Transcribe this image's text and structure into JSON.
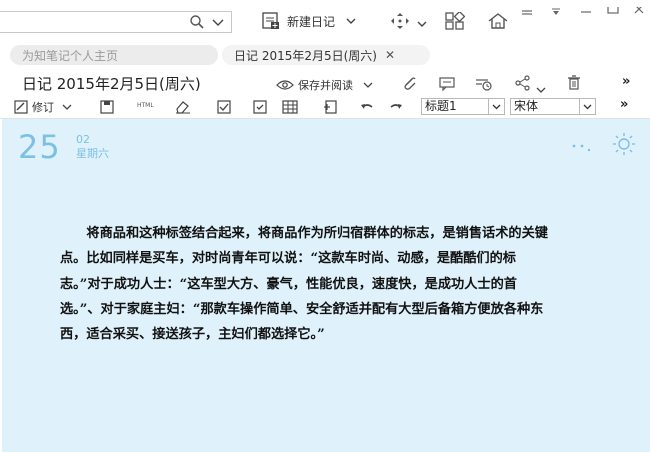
{
  "toolbar": {
    "new_note_label": "新建日记"
  },
  "tabs": [
    {
      "label": "为知笔记个人主页"
    },
    {
      "label": "日记 2015年2月5日(周六)",
      "close": "✕"
    }
  ],
  "note": {
    "title": "日记 2015年2月5日(周六)",
    "save_read_label": "保存并阅读",
    "revise_label": "修订",
    "heading_select": "标题1",
    "font_select": "宋体",
    "more": "»"
  },
  "date": {
    "day": "25",
    "month": "02",
    "weekday": "星期六"
  },
  "content": {
    "paragraph": "将商品和这种标签结合起来，将商品作为所归宿群体的标志，是销售话术的关键点。比如同样是买车，对时尚青年可以说：“这款车时尚、动感，是酷酷们的标志。”对于成功人士：“这车型大方、豪气，性能优良，速度快，是成功人士的首选。”、对于家庭主妇：“那款车操作简单、安全舒适并配有大型后备箱方便放各种东西，适合采买、接送孩子，主妇们都选择它。”"
  },
  "colors": {
    "content_bg": "#dff2fb",
    "date_accent": "#7cc0e4"
  }
}
